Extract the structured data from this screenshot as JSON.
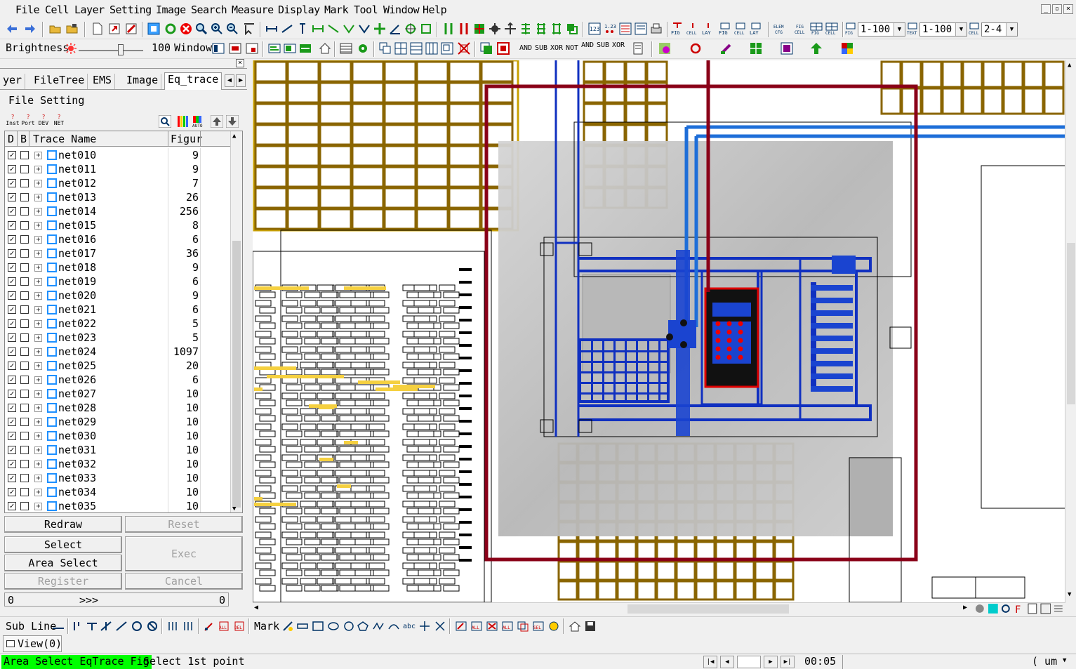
{
  "menu": [
    "File",
    "Cell",
    "Layer",
    "Setting",
    "Image",
    "Search",
    "Measure",
    "Display",
    "Mark",
    "Tool",
    "Window",
    "Help"
  ],
  "toolbar": {
    "scale1": "1-100",
    "scale2": "1-100",
    "scale3": "2-4",
    "brightness_label": "Brightness",
    "brightness_value": "100",
    "window_label": "Window",
    "logic_ops": [
      "AND",
      "SUB",
      "XOR",
      "NOT",
      "AND",
      "SUB",
      "XOR"
    ],
    "fig_labels": [
      "FIG",
      "CELL",
      "LAY",
      "FIG",
      "CELL",
      "LAY",
      "ELEM",
      "CFG",
      "FIG",
      "CELL",
      "FIG",
      "CELL",
      "FIG",
      "TEXT",
      "CELL"
    ]
  },
  "left_panel": {
    "tabs": [
      "yer",
      "FileTree",
      "EMS",
      "Image",
      "Eq_trace"
    ],
    "active_tab": "Eq_trace",
    "section_title": "File Setting",
    "filter_icons": [
      "Inst",
      "Port",
      "DEV",
      "NET"
    ],
    "columns": {
      "d": "D",
      "b": "B",
      "name": "Trace Name",
      "fig": "Figur"
    },
    "rows": [
      {
        "name": "net010",
        "fig": "9"
      },
      {
        "name": "net011",
        "fig": "9"
      },
      {
        "name": "net012",
        "fig": "7"
      },
      {
        "name": "net013",
        "fig": "26"
      },
      {
        "name": "net014",
        "fig": "256"
      },
      {
        "name": "net015",
        "fig": "8"
      },
      {
        "name": "net016",
        "fig": "6"
      },
      {
        "name": "net017",
        "fig": "36"
      },
      {
        "name": "net018",
        "fig": "9"
      },
      {
        "name": "net019",
        "fig": "6"
      },
      {
        "name": "net020",
        "fig": "9"
      },
      {
        "name": "net021",
        "fig": "6"
      },
      {
        "name": "net022",
        "fig": "5"
      },
      {
        "name": "net023",
        "fig": "5"
      },
      {
        "name": "net024",
        "fig": "1097"
      },
      {
        "name": "net025",
        "fig": "20"
      },
      {
        "name": "net026",
        "fig": "6"
      },
      {
        "name": "net027",
        "fig": "10"
      },
      {
        "name": "net028",
        "fig": "10"
      },
      {
        "name": "net029",
        "fig": "10"
      },
      {
        "name": "net030",
        "fig": "10"
      },
      {
        "name": "net031",
        "fig": "10"
      },
      {
        "name": "net032",
        "fig": "10"
      },
      {
        "name": "net033",
        "fig": "10"
      },
      {
        "name": "net034",
        "fig": "10"
      },
      {
        "name": "net035",
        "fig": "10"
      }
    ],
    "buttons": {
      "redraw": "Redraw",
      "reset": "Reset",
      "select": "Select",
      "exec": "Exec",
      "area_select": "Area Select",
      "register": "Register",
      "cancel": "Cancel"
    },
    "progress": {
      "left": "0",
      "mid": ">>>",
      "right": "0"
    }
  },
  "bottom_toolbar": {
    "sub_line": "Sub Line",
    "mark": "Mark",
    "abc": "abc"
  },
  "view": {
    "tab": "View(0)"
  },
  "status": {
    "mode": "Area Select EqTrace Fig",
    "message": "Select 1st point",
    "time": "00:05",
    "unit": "( um",
    "mode_color": "#00ff00"
  }
}
